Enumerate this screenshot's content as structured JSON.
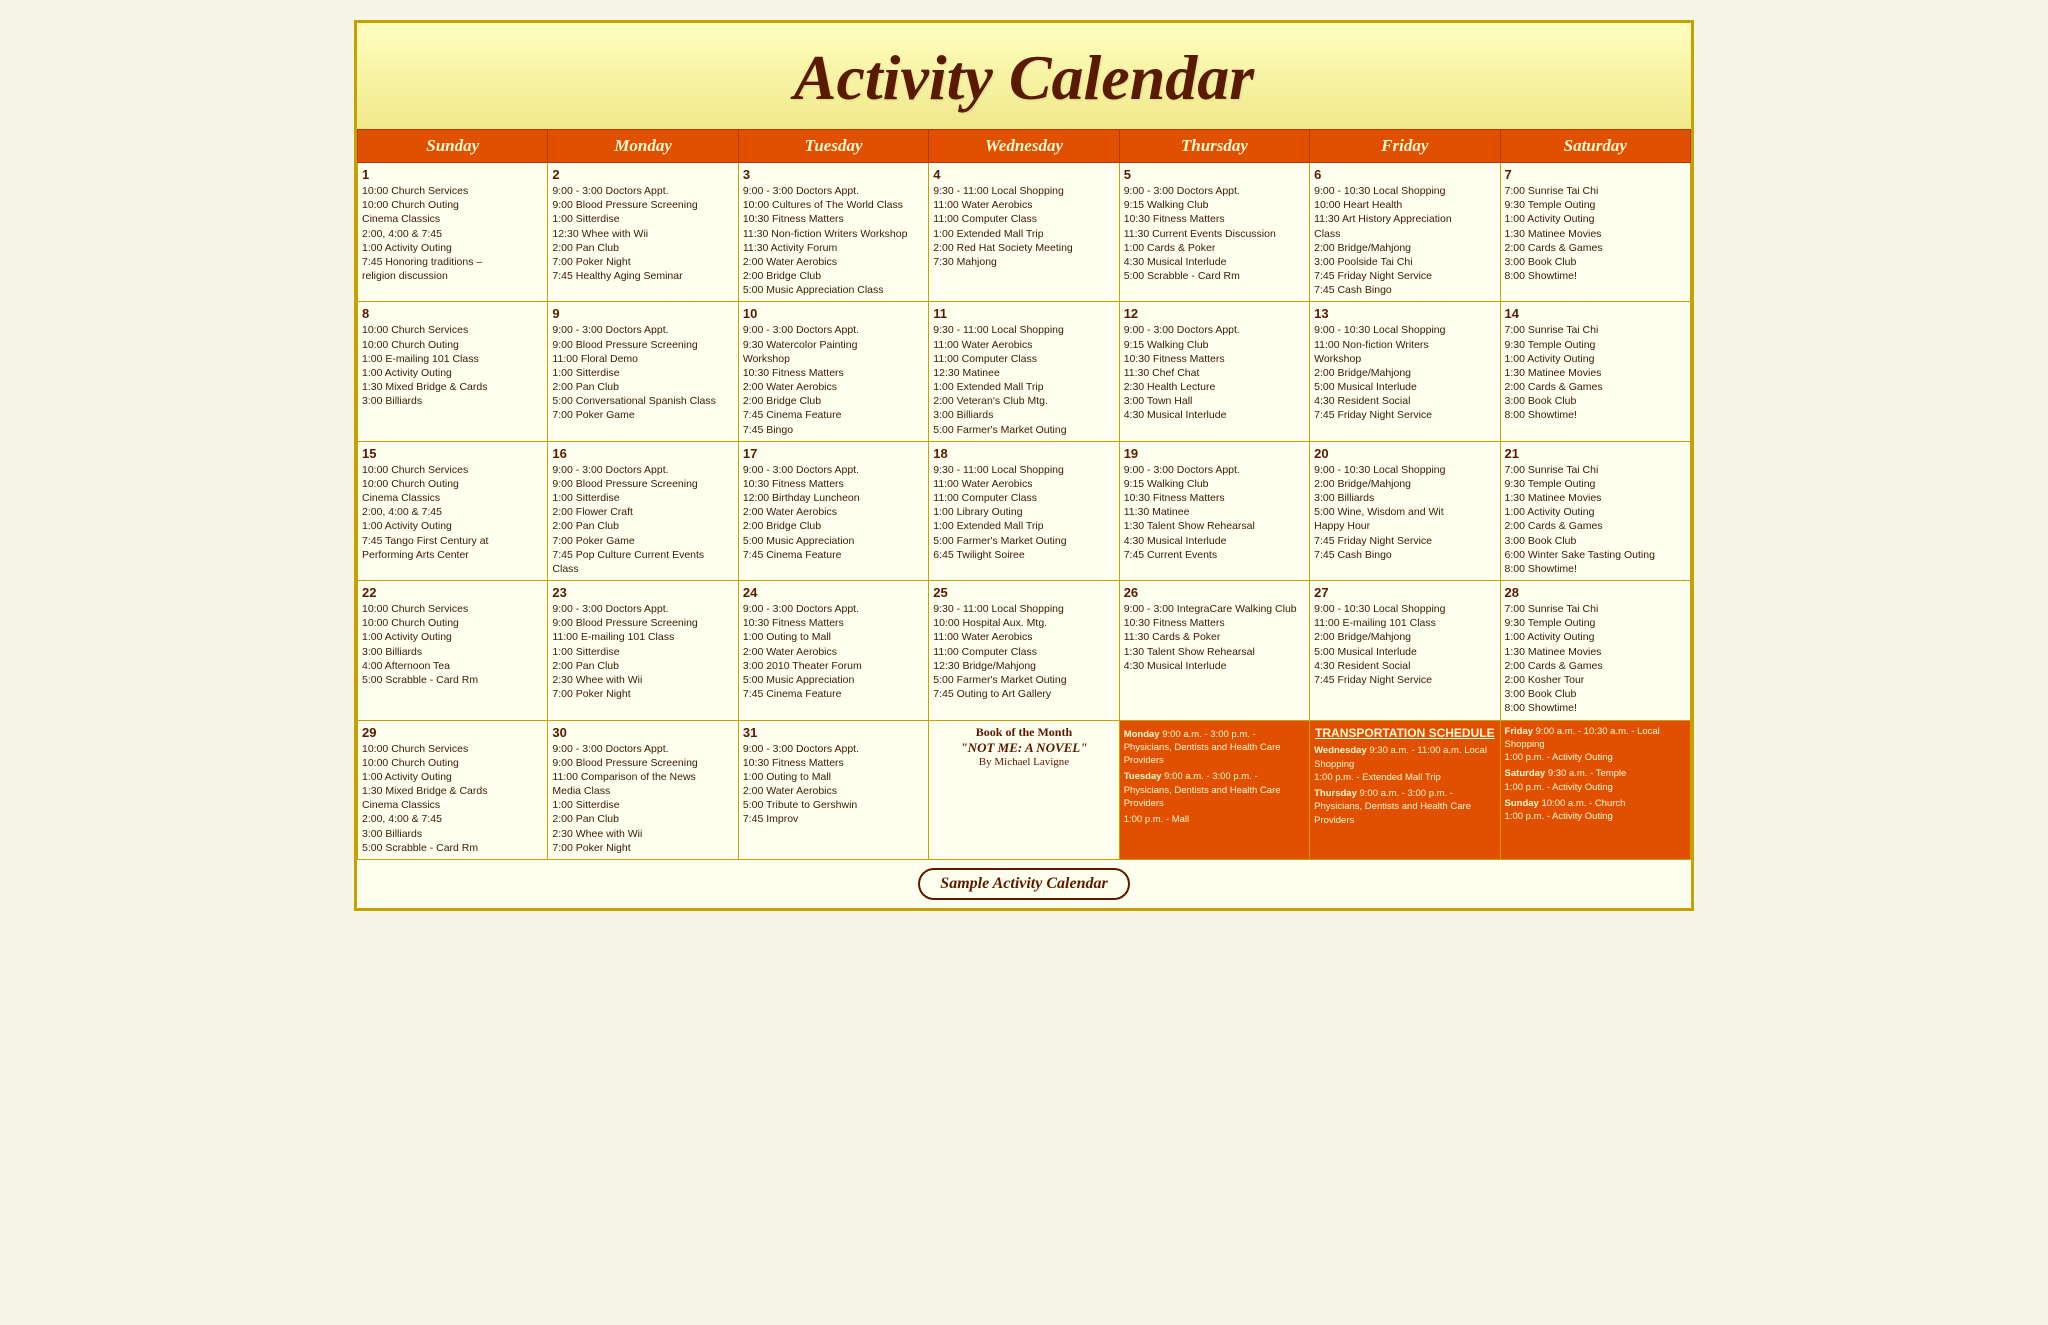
{
  "title": "Activity Calendar",
  "footer": "Sample Activity Calendar",
  "days_of_week": [
    "Sunday",
    "Monday",
    "Tuesday",
    "Wednesday",
    "Thursday",
    "Friday",
    "Saturday"
  ],
  "weeks": [
    {
      "days": [
        {
          "number": "1",
          "events": [
            "10:00 Church Services",
            "10:00 Church Outing",
            "Cinema Classics",
            "2:00, 4:00 & 7:45",
            "1:00  Activity Outing",
            "7:45 Honoring traditions –",
            "religion discussion"
          ]
        },
        {
          "number": "2",
          "events": [
            "9:00  -  3:00 Doctors Appt.",
            "9:00 Blood Pressure Screening",
            "1:00 Sitterdise",
            "12:30 Whee with Wii",
            "2:00 Pan Club",
            "7:00 Poker Night",
            "7:45 Healthy Aging Seminar"
          ]
        },
        {
          "number": "3",
          "events": [
            "9:00  -  3:00 Doctors Appt.",
            "10:00 Cultures of The World Class",
            "10:30 Fitness Matters",
            "11:30 Non-fiction Writers Workshop",
            "11:30 Activity Forum",
            "2:00 Water Aerobics",
            "2:00 Bridge Club",
            "5:00 Music Appreciation Class"
          ]
        },
        {
          "number": "4",
          "events": [
            "9:30  -  11:00 Local Shopping",
            "11:00 Water Aerobics",
            "11:00 Computer Class",
            "1:00 Extended Mall Trip",
            "2:00 Red Hat Society Meeting",
            "7:30 Mahjong"
          ]
        },
        {
          "number": "5",
          "events": [
            "9:00  -  3:00 Doctors Appt.",
            "9:15 Walking Club",
            "10:30 Fitness Matters",
            "11:30 Current Events Discussion",
            "1:00 Cards & Poker",
            "4:30 Musical Interlude",
            "5:00 Scrabble - Card Rm"
          ]
        },
        {
          "number": "6",
          "events": [
            "9:00  -  10:30 Local Shopping",
            "10:00 Heart Health",
            "11:30 Art History Appreciation",
            "Class",
            "2:00 Bridge/Mahjong",
            "3:00 Poolside Tai Chi",
            "7:45 Friday Night Service",
            "7:45 Cash Bingo"
          ]
        },
        {
          "number": "7",
          "events": [
            "7:00 Sunrise Tai Chi",
            "9:30 Temple Outing",
            "1:00  Activity Outing",
            "1:30 Matinee Movies",
            "2:00 Cards & Games",
            "3:00 Book Club",
            "8:00 Showtime!"
          ]
        }
      ]
    },
    {
      "days": [
        {
          "number": "8",
          "events": [
            "10:00 Church Services",
            "10:00 Church Outing",
            "1:00 E-mailing 101 Class",
            "1:00  Activity Outing",
            "1:30 Mixed Bridge & Cards",
            "3:00 Billiards"
          ]
        },
        {
          "number": "9",
          "events": [
            "9:00  -  3:00 Doctors Appt.",
            "9:00 Blood Pressure Screening",
            "11:00 Floral Demo",
            "1:00 Sitterdise",
            "2:00 Pan Club",
            "5:00 Conversational Spanish Class",
            "7:00 Poker Game"
          ]
        },
        {
          "number": "10",
          "events": [
            "9:00  -  3:00 Doctors Appt.",
            "9:30 Watercolor Painting",
            "Workshop",
            "10:30 Fitness Matters",
            "2:00 Water Aerobics",
            "2:00 Bridge Club",
            "7:45 Cinema Feature",
            "7:45 Bingo"
          ]
        },
        {
          "number": "11",
          "events": [
            "9:30  -  11:00 Local Shopping",
            "11:00 Water Aerobics",
            "11:00 Computer Class",
            "12:30 Matinee",
            "1:00 Extended Mall Trip",
            "2:00 Veteran's Club Mtg.",
            "3:00 Billiards",
            "5:00 Farmer's Market Outing"
          ]
        },
        {
          "number": "12",
          "events": [
            "9:00  -  3:00 Doctors Appt.",
            "9:15 Walking Club",
            "10:30 Fitness Matters",
            "11:30 Chef Chat",
            "2:30 Health Lecture",
            "3:00 Town Hall",
            "4:30 Musical Interlude"
          ]
        },
        {
          "number": "13",
          "events": [
            "9:00  -  10:30 Local Shopping",
            "11:00 Non-fiction Writers",
            "Workshop",
            "2:00 Bridge/Mahjong",
            "5:00 Musical Interlude",
            "4:30 Resident Social",
            "7:45 Friday Night Service"
          ]
        },
        {
          "number": "14",
          "events": [
            "7:00 Sunrise Tai Chi",
            "9:30 Temple Outing",
            "1:00  Activity Outing",
            "1:30 Matinee Movies",
            "2:00 Cards & Games",
            "3:00 Book Club",
            "8:00 Showtime!"
          ]
        }
      ]
    },
    {
      "days": [
        {
          "number": "15",
          "events": [
            "10:00 Church Services",
            "10:00 Church Outing",
            "Cinema Classics",
            "2:00, 4:00 & 7:45",
            "1:00  Activity Outing",
            "7:45 Tango First Century at",
            "Performing Arts Center"
          ]
        },
        {
          "number": "16",
          "events": [
            "9:00  -  3:00 Doctors Appt.",
            "9:00 Blood Pressure Screening",
            "1:00 Sitterdise",
            "2:00 Flower Craft",
            "2:00 Pan Club",
            "7:00 Poker Game",
            "7:45 Pop Culture Current Events",
            "Class"
          ]
        },
        {
          "number": "17",
          "events": [
            "9:00  -  3:00 Doctors Appt.",
            "10:30 Fitness Matters",
            "12:00 Birthday Luncheon",
            "2:00 Water Aerobics",
            "2:00 Bridge Club",
            "5:00 Music Appreciation",
            "7:45 Cinema Feature"
          ]
        },
        {
          "number": "18",
          "events": [
            "9:30  -  11:00 Local Shopping",
            "11:00 Water Aerobics",
            "11:00 Computer Class",
            "1:00 Library Outing",
            "1:00 Extended Mall Trip",
            "5:00 Farmer's Market Outing",
            "6:45 Twilight Soiree"
          ]
        },
        {
          "number": "19",
          "events": [
            "9:00  -  3:00 Doctors Appt.",
            "9:15 Walking Club",
            "10:30 Fitness Matters",
            "11:30 Matinee",
            "1:30 Talent Show Rehearsal",
            "4:30 Musical Interlude",
            "7:45 Current Events"
          ]
        },
        {
          "number": "20",
          "events": [
            "9:00  -  10:30 Local Shopping",
            "2:00 Bridge/Mahjong",
            "3:00 Billiards",
            "5:00 Wine, Wisdom and Wit",
            "Happy Hour",
            "7:45 Friday Night Service",
            "7:45 Cash Bingo"
          ]
        },
        {
          "number": "21",
          "events": [
            "7:00 Sunrise Tai Chi",
            "9:30 Temple Outing",
            "1:30 Matinee Movies",
            "1:00  Activity Outing",
            "2:00 Cards & Games",
            "3:00 Book Club",
            "6:00 Winter Sake Tasting Outing",
            "8:00 Showtime!"
          ]
        }
      ]
    },
    {
      "days": [
        {
          "number": "22",
          "events": [
            "10:00 Church Services",
            "10:00 Church Outing",
            "1:00  Activity Outing",
            "3:00 Billiards",
            "4:00 Afternoon Tea",
            "5:00 Scrabble - Card Rm"
          ]
        },
        {
          "number": "23",
          "events": [
            "9:00  -  3:00 Doctors Appt.",
            "9:00 Blood Pressure Screening",
            "11:00 E-mailing 101 Class",
            "1:00 Sitterdise",
            "2:00 Pan Club",
            "2:30 Whee with Wii",
            "7:00 Poker Night"
          ]
        },
        {
          "number": "24",
          "events": [
            "9:00  -  3:00 Doctors Appt.",
            "10:30 Fitness Matters",
            "1:00 Outing to Mall",
            "2:00 Water Aerobics",
            "3:00 2010 Theater Forum",
            "5:00 Music Appreciation",
            "7:45 Cinema Feature"
          ]
        },
        {
          "number": "25",
          "events": [
            "9:30  -  11:00 Local Shopping",
            "10:00 Hospital Aux. Mtg.",
            "11:00 Water Aerobics",
            "11:00 Computer Class",
            "12:30 Bridge/Mahjong",
            "5:00 Farmer's Market Outing",
            "7:45 Outing to Art Gallery"
          ]
        },
        {
          "number": "26",
          "events": [
            "9:00  -  3:00 IntegraCare Walking Club",
            "10:30 Fitness Matters",
            "11:30 Cards & Poker",
            "1:30 Talent Show Rehearsal",
            "4:30 Musical Interlude"
          ]
        },
        {
          "number": "27",
          "events": [
            "9:00  -  10:30 Local Shopping",
            "11:00 E-mailing 101 Class",
            "2:00 Bridge/Mahjong",
            "5:00 Musical Interlude",
            "4:30 Resident Social",
            "7:45 Friday Night Service"
          ]
        },
        {
          "number": "28",
          "events": [
            "7:00 Sunrise Tai Chi",
            "9:30 Temple Outing",
            "1:00  Activity Outing",
            "1:30 Matinee Movies",
            "2:00 Cards & Games",
            "2:00 Kosher Tour",
            "3:00 Book Club",
            "8:00 Showtime!"
          ]
        }
      ]
    },
    {
      "days": [
        {
          "number": "29",
          "events": [
            "10:00 Church Services",
            "10:00 Church Outing",
            "1:00  Activity Outing",
            "1:30 Mixed Bridge & Cards",
            "Cinema Classics",
            "2:00, 4:00 & 7:45",
            "3:00 Billiards",
            "5:00 Scrabble - Card Rm"
          ]
        },
        {
          "number": "30",
          "events": [
            "9:00  -  3:00 Doctors Appt.",
            "9:00 Blood Pressure Screening",
            "11:00 Comparison of the News",
            "Media Class",
            "1:00 Sitterdise",
            "2:00 Pan Club",
            "2:30 Whee with Wii",
            "7:00 Poker Night"
          ]
        },
        {
          "number": "31",
          "events": [
            "9:00  -  3:00 Doctors Appt.",
            "10:30 Fitness Matters",
            "1:00 Outing to Mall",
            "2:00 Water Aerobics",
            "5:00 Tribute to Gershwin",
            "7:45 Improv"
          ]
        }
      ],
      "book_of_month": {
        "label": "Book of the Month",
        "title": "\"NOT ME: A NOVEL\"",
        "author": "By Michael Lavigne"
      },
      "transport": {
        "header": "TRANSPORTATION SCHEDULE",
        "monday": "Monday 9:00 a.m. - 3:00 p.m. - Physicians, Dentists and Health Care Providers",
        "tuesday": "Tuesday 9:00 a.m. - 3:00 p.m. - Physicians, Dentists and Health Care Providers",
        "wednesday": "Wednesday 9:30 a.m. - 11:00 a.m. Local Shopping\n1:00 p.m. - Extended Mall Trip",
        "thursday": "Thursday 9:00 a.m. - 3:00 p.m. - Physicians, Dentists and Health Care Providers",
        "friday": "Friday 9:00 a.m. - 10:30 a.m. - Local Shopping\n1:00 p.m. - Activity Outing",
        "saturday": "Saturday 9:30 a.m. - Temple\n1:00 p.m. - Activity Outing",
        "sunday": "Sunday 10:00 a.m. - Church\n1:00 p.m. - Activity Outing",
        "thursday_mall": "1:00 p.m. - Mall"
      }
    }
  ]
}
